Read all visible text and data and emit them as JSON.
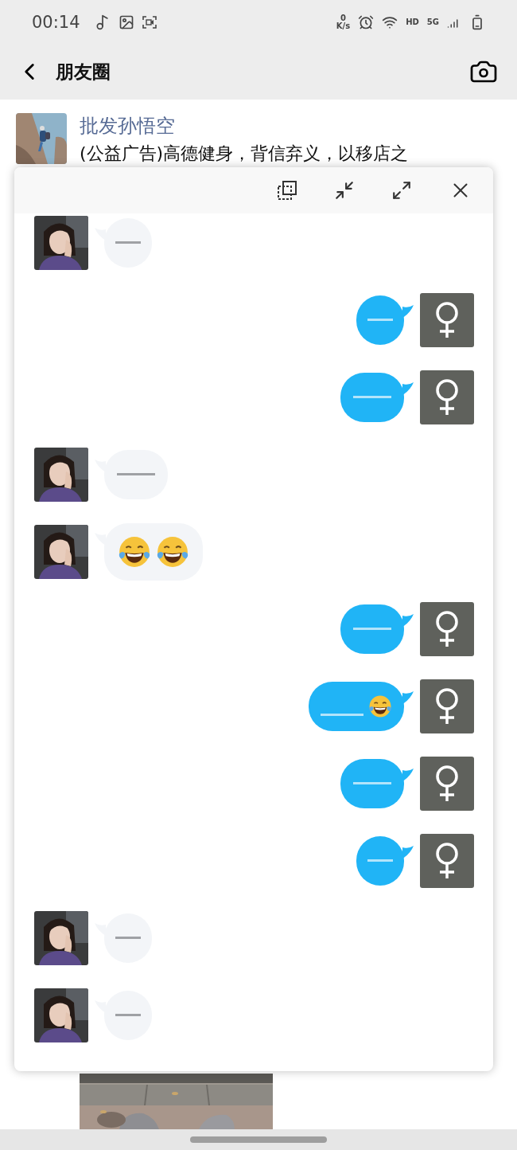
{
  "status_bar": {
    "time": "00:14",
    "net_speed_value": "0",
    "net_speed_unit": "K/s",
    "hd": "HD",
    "network": "5G"
  },
  "header": {
    "title": "朋友圈"
  },
  "post": {
    "author": "批发孙悟空",
    "text": "(公益广告)高德健身，背信弃义，以移店之"
  },
  "viewer": {
    "messages": [
      {
        "sent": false,
        "kind": "text"
      },
      {
        "sent": true,
        "kind": "text"
      },
      {
        "sent": true,
        "kind": "text_long"
      },
      {
        "sent": false,
        "kind": "text_long"
      },
      {
        "sent": false,
        "kind": "emoji"
      },
      {
        "sent": true,
        "kind": "text_long"
      },
      {
        "sent": true,
        "kind": "text_emoji"
      },
      {
        "sent": true,
        "kind": "text_long"
      },
      {
        "sent": true,
        "kind": "text"
      },
      {
        "sent": false,
        "kind": "text"
      },
      {
        "sent": false,
        "kind": "text"
      }
    ]
  }
}
